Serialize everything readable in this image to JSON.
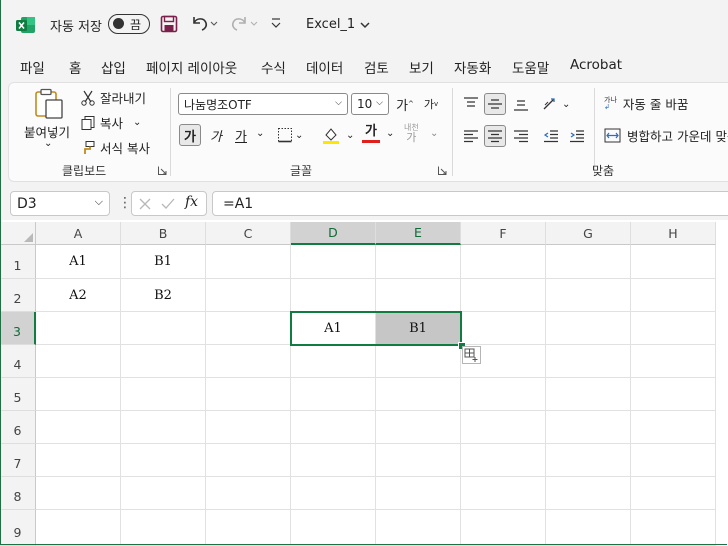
{
  "titlebar": {
    "autosave_label": "자동 저장",
    "autosave_state": "끔",
    "document_title": "Excel_1"
  },
  "menu": {
    "tabs": [
      "파일",
      "홈",
      "삽입",
      "페이지 레이아웃",
      "수식",
      "데이터",
      "검토",
      "보기",
      "자동화",
      "도움말",
      "Acrobat"
    ],
    "active": "홈"
  },
  "ribbon": {
    "clipboard": {
      "paste": "붙여넣기",
      "cut": "잘라내기",
      "copy": "복사",
      "format_painter": "서식 복사",
      "group_label": "클립보드"
    },
    "font": {
      "font_name": "나눔명조OTF",
      "font_size": "10",
      "grow": "가",
      "shrink": "가",
      "bold": "가",
      "italic": "가",
      "underline": "가",
      "font_color_glyph": "가",
      "phonetic_top": "내천",
      "phonetic_bottom": "가",
      "highlight_color": "#ffe600",
      "font_color": "#e0201c",
      "group_label": "글꼴"
    },
    "alignment": {
      "wrap_text": "자동 줄 바꿈",
      "wrap_icon_text": "가나",
      "merge_center": "병합하고 가운데 맞춤",
      "group_label": "맞춤"
    }
  },
  "formula_bar": {
    "name_box": "D3",
    "formula": "=A1",
    "fx": "fx"
  },
  "sheet": {
    "columns": [
      "A",
      "B",
      "C",
      "D",
      "E",
      "F",
      "G",
      "H"
    ],
    "rows": [
      "1",
      "2",
      "3",
      "4",
      "5",
      "6",
      "7",
      "8",
      "9"
    ],
    "selected_column_headers": [
      "D",
      "E"
    ],
    "selected_row_header": "3",
    "cells": {
      "A1": "A1",
      "B1": "B1",
      "A2": "A2",
      "B2": "B2",
      "D3": "A1",
      "E3": "B1"
    },
    "accent_color": "#107c41"
  }
}
